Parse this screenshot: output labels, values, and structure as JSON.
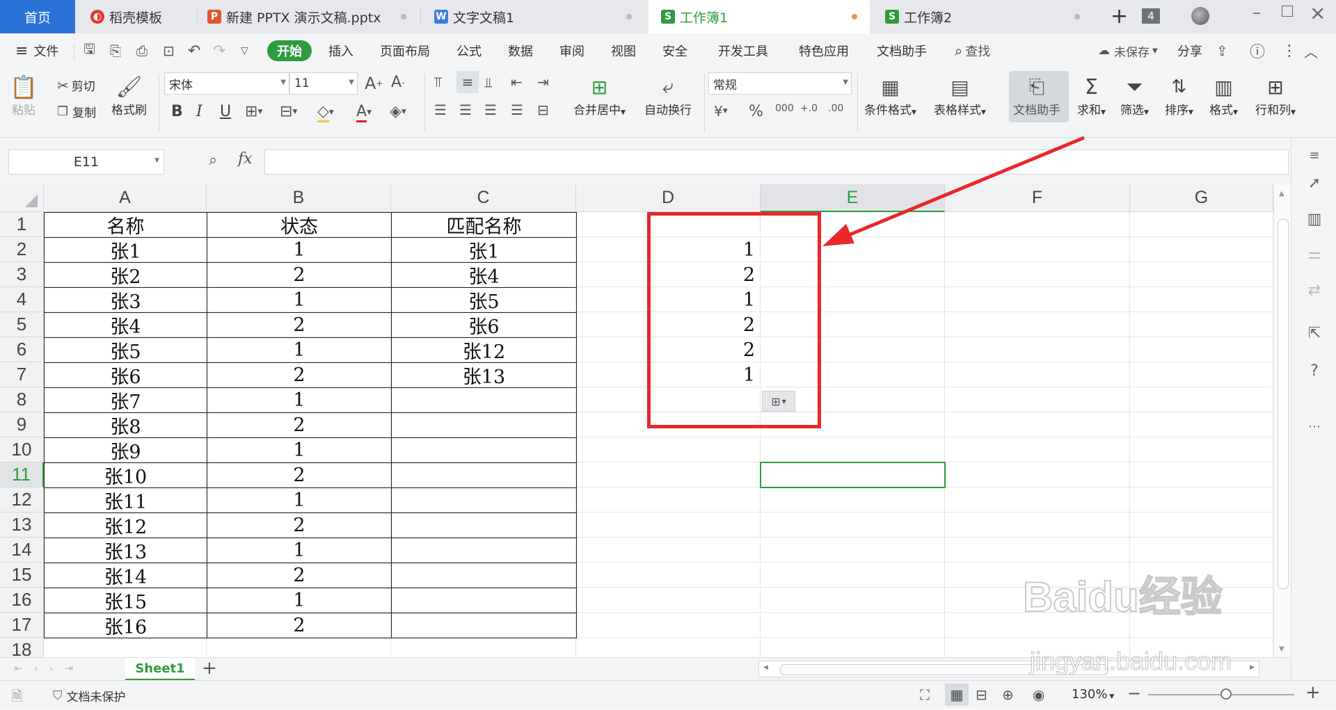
{
  "tabs": {
    "home": "首页",
    "docer": "稻壳模板",
    "pptx": "新建 PPTX 演示文稿.pptx",
    "doc": "文字文稿1",
    "book1": "工作簿1",
    "book2": "工作簿2",
    "window_count": "4"
  },
  "menu": {
    "file": "文件",
    "start": "开始",
    "insert": "插入",
    "layout": "页面布局",
    "formula": "公式",
    "data": "数据",
    "review": "审阅",
    "view": "视图",
    "security": "安全",
    "devtools": "开发工具",
    "special": "特色应用",
    "doc_helper": "文档助手",
    "find": "查找",
    "unsaved": "未保存",
    "share": "分享"
  },
  "ribbon": {
    "paste": "粘贴",
    "cut": "剪切",
    "copy": "复制",
    "format_painter": "格式刷",
    "font_name": "宋体",
    "font_size": "11",
    "merge_center": "合并居中",
    "wrap_text": "自动换行",
    "number_format": "常规",
    "cond_format": "条件格式",
    "table_style": "表格样式",
    "doc_assistant": "文档助手",
    "sum": "求和",
    "filter": "筛选",
    "sort": "排序",
    "format": "格式",
    "row_col": "行和列"
  },
  "formula_bar": {
    "name_box": "E11",
    "fx": "fx",
    "value": ""
  },
  "columns": [
    "A",
    "B",
    "C",
    "D",
    "E",
    "F",
    "G"
  ],
  "rows": [
    "1",
    "2",
    "3",
    "4",
    "5",
    "6",
    "7",
    "8",
    "9",
    "10",
    "11",
    "12",
    "13",
    "14",
    "15",
    "16",
    "17",
    "18"
  ],
  "cells": {
    "A": [
      "名称",
      "张1",
      "张2",
      "张3",
      "张4",
      "张5",
      "张6",
      "张7",
      "张8",
      "张9",
      "张10",
      "张11",
      "张12",
      "张13",
      "张14",
      "张15",
      "张16"
    ],
    "B": [
      "状态",
      "1",
      "2",
      "1",
      "2",
      "1",
      "2",
      "1",
      "2",
      "1",
      "2",
      "1",
      "2",
      "1",
      "2",
      "1",
      "2"
    ],
    "C": [
      "匹配名称",
      "张1",
      "张4",
      "张5",
      "张6",
      "张12",
      "张13"
    ],
    "D": [
      "",
      "1",
      "2",
      "1",
      "2",
      "2",
      "1"
    ]
  },
  "active_cell": "E11",
  "sheet": {
    "name": "Sheet1"
  },
  "status": {
    "protect": "文档未保护",
    "zoom": "130%"
  },
  "watermark": {
    "brand": "Baidu经验",
    "url": "jingyan.baidu.com"
  },
  "colors": {
    "accent_green": "#2e9b3e",
    "annotation_red": "#e8282b",
    "tab_active_bg": "#ffffff",
    "selected_col_hdr": "#e1e3e6"
  }
}
